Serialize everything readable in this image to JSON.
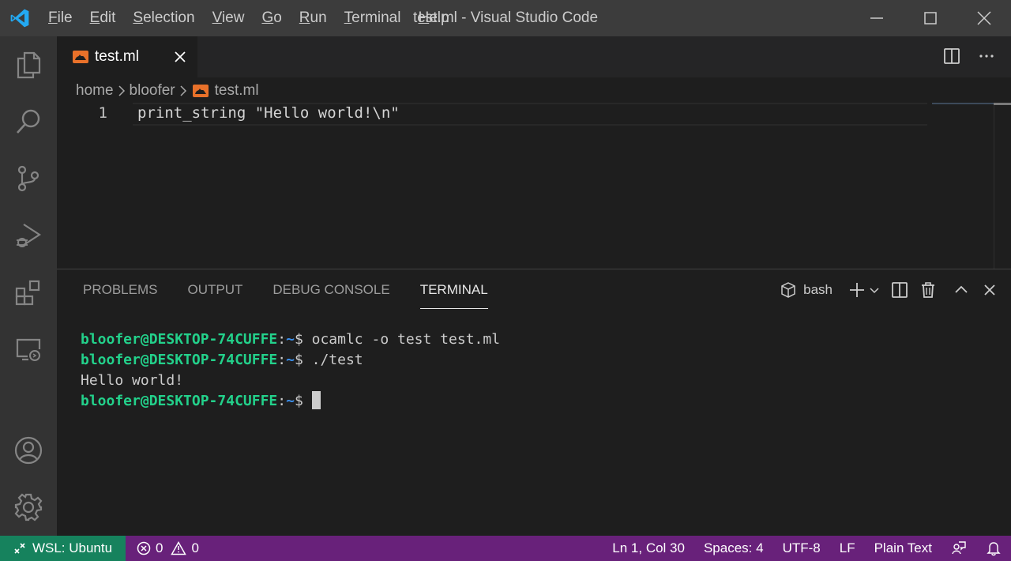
{
  "window": {
    "title": "test.ml - Visual Studio Code",
    "menu": [
      {
        "acc": "F",
        "rest": "ile"
      },
      {
        "acc": "E",
        "rest": "dit"
      },
      {
        "acc": "S",
        "rest": "election"
      },
      {
        "acc": "V",
        "rest": "iew"
      },
      {
        "acc": "G",
        "rest": "o"
      },
      {
        "acc": "R",
        "rest": "un"
      },
      {
        "acc": "T",
        "rest": "erminal"
      },
      {
        "acc": "H",
        "rest": "elp"
      }
    ]
  },
  "activity_bar": {
    "icons": [
      "explorer-icon",
      "search-icon",
      "source-control-icon",
      "run-debug-icon",
      "extensions-icon",
      "remote-explorer-icon",
      "accounts-icon",
      "settings-gear-icon"
    ]
  },
  "editor": {
    "tab": {
      "label": "test.ml",
      "icon": "ocaml-file-icon"
    },
    "breadcrumb": [
      "home",
      "bloofer",
      "test.ml"
    ],
    "lines": [
      {
        "number": "1",
        "text": "print_string \"Hello world!\\n\""
      }
    ]
  },
  "panel": {
    "tabs": [
      "PROBLEMS",
      "OUTPUT",
      "DEBUG CONSOLE",
      "TERMINAL"
    ],
    "active_tab": "TERMINAL",
    "shell": "bash",
    "terminal": {
      "user_host": "bloofer@DESKTOP-74CUFFE",
      "sep": ":",
      "path": "~",
      "prompt": "$",
      "commands": [
        "ocamlc -o test test.ml",
        "./test"
      ],
      "output": "Hello world!"
    }
  },
  "status_bar": {
    "remote": "WSL: Ubuntu",
    "errors": "0",
    "warnings": "0",
    "position": "Ln 1, Col 30",
    "spaces": "Spaces: 4",
    "encoding": "UTF-8",
    "eol": "LF",
    "language": "Plain Text"
  },
  "colors": {
    "status_bar": "#68217a",
    "remote_indicator": "#16825d",
    "terminal_user": "#23d18b",
    "terminal_path": "#3b8eea",
    "ocaml_icon": "#e8712a",
    "vscode_logo": "#23a9f2"
  }
}
